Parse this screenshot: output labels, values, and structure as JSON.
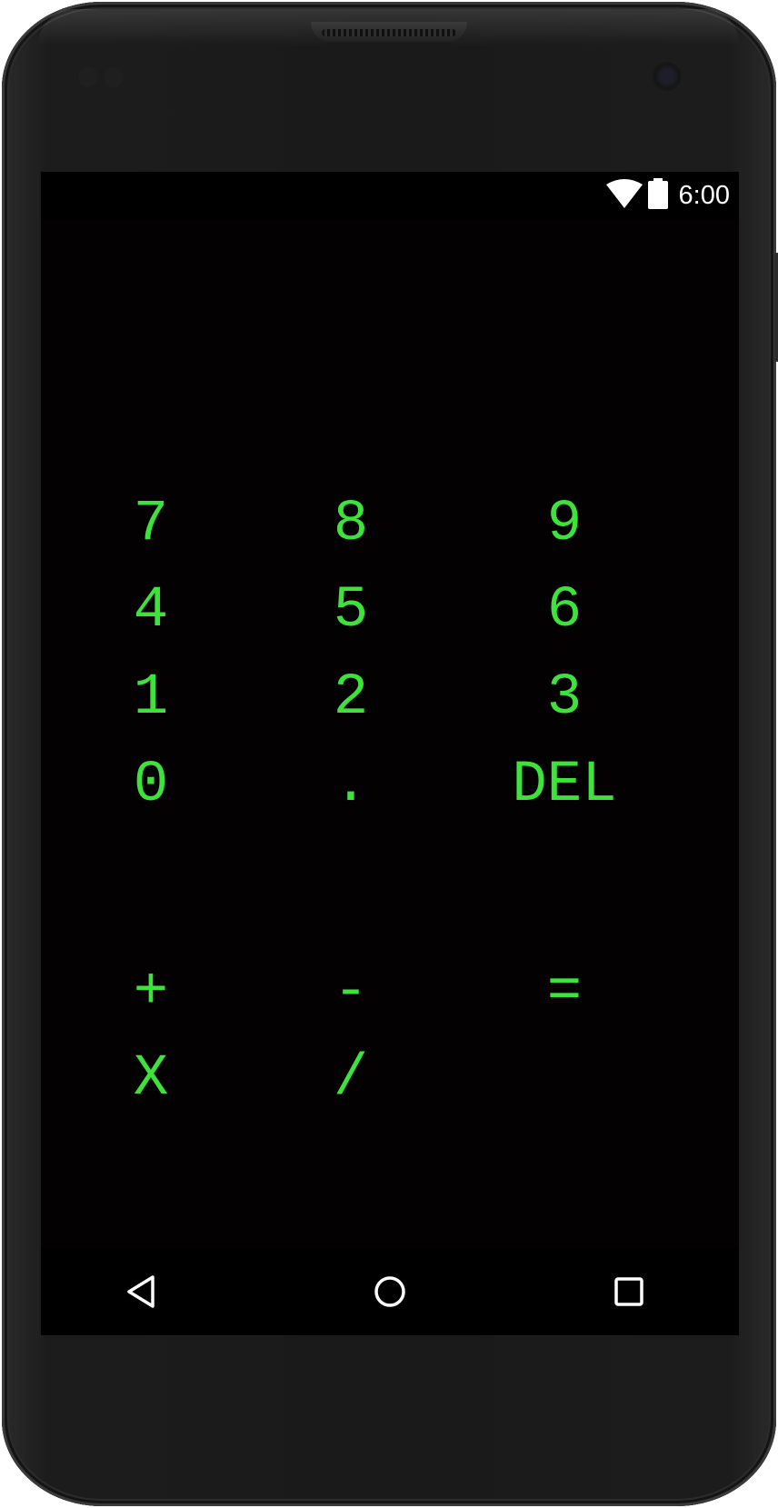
{
  "status_bar": {
    "time": "6:00",
    "icons": [
      "wifi-icon",
      "battery-icon"
    ]
  },
  "keypad": {
    "rows": [
      [
        "7",
        "8",
        "9"
      ],
      [
        "4",
        "5",
        "6"
      ],
      [
        "1",
        "2",
        "3"
      ],
      [
        "0",
        ".",
        "DEL"
      ]
    ]
  },
  "operators": {
    "rows": [
      [
        "+",
        "-",
        "="
      ],
      [
        "X",
        "/"
      ]
    ]
  },
  "nav_bar": {
    "icons": [
      "back-icon",
      "home-icon",
      "recents-icon"
    ]
  },
  "colors": {
    "screen_background": "#040102",
    "key_text": "#3de23a",
    "status_text": "#ffffff",
    "bars": "#000000"
  }
}
